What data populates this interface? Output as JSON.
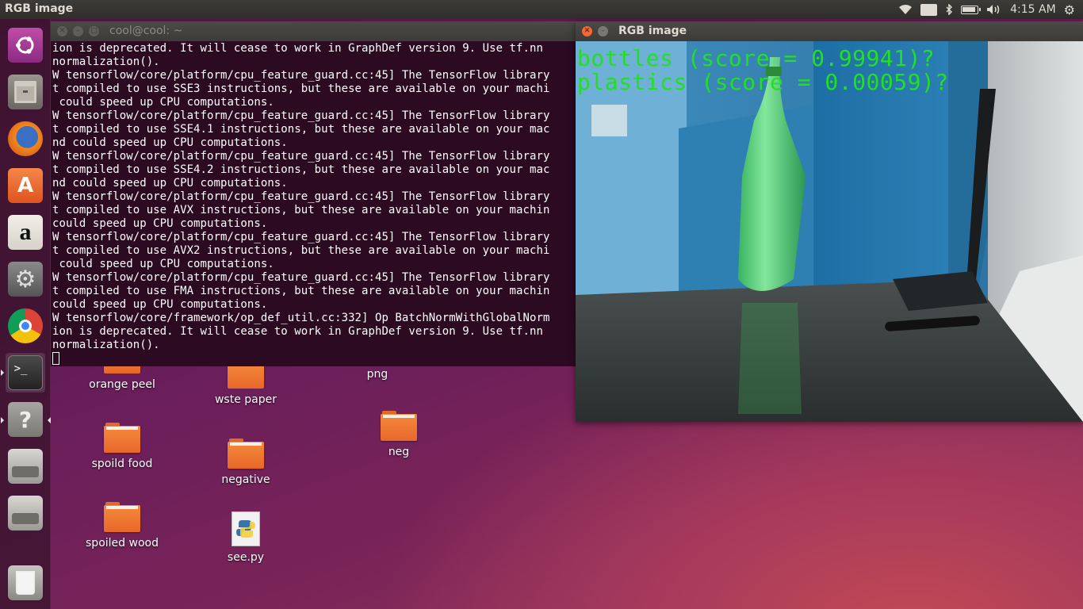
{
  "panel": {
    "active_window_title": "RGB image",
    "keyboard_layout": "En",
    "clock": "4:15 AM"
  },
  "launcher": {
    "items": [
      {
        "name": "Dash"
      },
      {
        "name": "Files"
      },
      {
        "name": "Firefox Web Browser"
      },
      {
        "name": "Ubuntu Software"
      },
      {
        "name": "Amazon"
      },
      {
        "name": "System Settings"
      },
      {
        "name": "Google Chrome"
      },
      {
        "name": "Terminal"
      },
      {
        "name": "Help"
      },
      {
        "name": "Drive 1"
      },
      {
        "name": "Drive 2"
      },
      {
        "name": "Trash"
      }
    ]
  },
  "terminal": {
    "title": "cool@cool: ~",
    "lines": [
      "ion is deprecated. It will cease to work in GraphDef version 9. Use tf.nn",
      "normalization().",
      "W tensorflow/core/platform/cpu_feature_guard.cc:45] The TensorFlow library",
      "t compiled to use SSE3 instructions, but these are available on your machi",
      " could speed up CPU computations.",
      "W tensorflow/core/platform/cpu_feature_guard.cc:45] The TensorFlow library",
      "t compiled to use SSE4.1 instructions, but these are available on your mac",
      "nd could speed up CPU computations.",
      "W tensorflow/core/platform/cpu_feature_guard.cc:45] The TensorFlow library",
      "t compiled to use SSE4.2 instructions, but these are available on your mac",
      "nd could speed up CPU computations.",
      "W tensorflow/core/platform/cpu_feature_guard.cc:45] The TensorFlow library",
      "t compiled to use AVX instructions, but these are available on your machin",
      "could speed up CPU computations.",
      "W tensorflow/core/platform/cpu_feature_guard.cc:45] The TensorFlow library",
      "t compiled to use AVX2 instructions, but these are available on your machi",
      " could speed up CPU computations.",
      "W tensorflow/core/platform/cpu_feature_guard.cc:45] The TensorFlow library",
      "t compiled to use FMA instructions, but these are available on your machin",
      "could speed up CPU computations.",
      "W tensorflow/core/framework/op_def_util.cc:332] Op BatchNormWithGlobalNorm",
      "ion is deprecated. It will cease to work in GraphDef version 9. Use tf.nn",
      "normalization()."
    ]
  },
  "desktop": {
    "icons": [
      {
        "label": "orange peel",
        "type": "folder"
      },
      {
        "label": "wste paper",
        "type": "folder"
      },
      {
        "label": "png",
        "type": "folder"
      },
      {
        "label": "spoild food",
        "type": "folder"
      },
      {
        "label": "negative",
        "type": "folder"
      },
      {
        "label": "neg",
        "type": "folder"
      },
      {
        "label": "spoiled wood",
        "type": "folder"
      },
      {
        "label": "see.py",
        "type": "python-file"
      }
    ]
  },
  "rgb_window": {
    "title": "RGB image",
    "overlay_lines": [
      "bottles (score = 0.99941)?",
      "plastics (score = 0.00059)?"
    ],
    "overlay_color": "#22e020"
  },
  "colors": {
    "panel": "#3c3b37",
    "terminal_bg": "#2c0a22",
    "close_button": "#f46737",
    "folder_orange": "#f0793a"
  }
}
